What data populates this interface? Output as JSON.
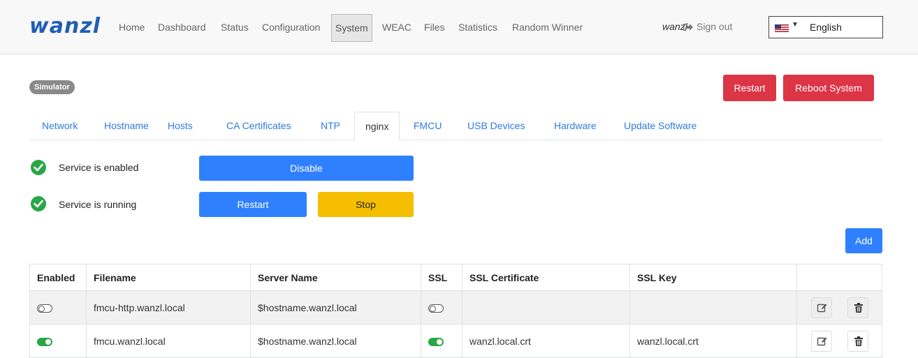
{
  "brand": "wanzl",
  "nav": {
    "items": [
      "Home",
      "Dashboard",
      "Status",
      "Configuration",
      "System",
      "WEAC",
      "Files",
      "Statistics",
      "Random Winner"
    ],
    "user": "wanzl",
    "signout": "Sign out",
    "language": "English"
  },
  "badge": "Simulator",
  "header_buttons": {
    "restart": "Restart",
    "reboot": "Reboot System"
  },
  "tabs": [
    "Network",
    "Hostname",
    "Hosts",
    "CA Certificates",
    "NTP",
    "nginx",
    "FMCU",
    "USB Devices",
    "Hardware",
    "Update Software"
  ],
  "service": {
    "enabled_label": "Service is enabled",
    "running_label": "Service is running",
    "disable_button": "Disable",
    "restart_button": "Restart",
    "stop_button": "Stop"
  },
  "add_button": "Add",
  "table": {
    "headers": [
      "Enabled",
      "Filename",
      "Server Name",
      "SSL",
      "SSL Certificate",
      "SSL Key",
      ""
    ],
    "rows": [
      {
        "enabled": false,
        "filename": "fmcu-http.wanzl.local",
        "server_name": "$hostname.wanzl.local",
        "ssl": false,
        "ssl_certificate": "",
        "ssl_key": ""
      },
      {
        "enabled": true,
        "filename": "fmcu.wanzl.local",
        "server_name": "$hostname.wanzl.local",
        "ssl": true,
        "ssl_certificate": "wanzl.local.crt",
        "ssl_key": "wanzl.local.crt"
      }
    ]
  },
  "colors": {
    "primary": "#2f80ff",
    "danger": "#dc3545",
    "warning": "#f5bf00",
    "success": "#28a745",
    "brand": "#1f5fb4"
  }
}
